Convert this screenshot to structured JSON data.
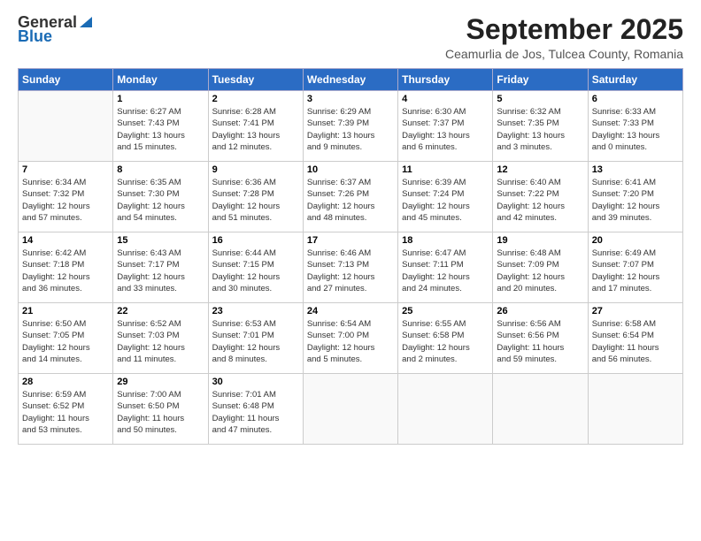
{
  "header": {
    "logo_general": "General",
    "logo_blue": "Blue",
    "month_title": "September 2025",
    "subtitle": "Ceamurlia de Jos, Tulcea County, Romania"
  },
  "weekdays": [
    "Sunday",
    "Monday",
    "Tuesday",
    "Wednesday",
    "Thursday",
    "Friday",
    "Saturday"
  ],
  "weeks": [
    [
      {
        "day": "",
        "info": ""
      },
      {
        "day": "1",
        "info": "Sunrise: 6:27 AM\nSunset: 7:43 PM\nDaylight: 13 hours\nand 15 minutes."
      },
      {
        "day": "2",
        "info": "Sunrise: 6:28 AM\nSunset: 7:41 PM\nDaylight: 13 hours\nand 12 minutes."
      },
      {
        "day": "3",
        "info": "Sunrise: 6:29 AM\nSunset: 7:39 PM\nDaylight: 13 hours\nand 9 minutes."
      },
      {
        "day": "4",
        "info": "Sunrise: 6:30 AM\nSunset: 7:37 PM\nDaylight: 13 hours\nand 6 minutes."
      },
      {
        "day": "5",
        "info": "Sunrise: 6:32 AM\nSunset: 7:35 PM\nDaylight: 13 hours\nand 3 minutes."
      },
      {
        "day": "6",
        "info": "Sunrise: 6:33 AM\nSunset: 7:33 PM\nDaylight: 13 hours\nand 0 minutes."
      }
    ],
    [
      {
        "day": "7",
        "info": "Sunrise: 6:34 AM\nSunset: 7:32 PM\nDaylight: 12 hours\nand 57 minutes."
      },
      {
        "day": "8",
        "info": "Sunrise: 6:35 AM\nSunset: 7:30 PM\nDaylight: 12 hours\nand 54 minutes."
      },
      {
        "day": "9",
        "info": "Sunrise: 6:36 AM\nSunset: 7:28 PM\nDaylight: 12 hours\nand 51 minutes."
      },
      {
        "day": "10",
        "info": "Sunrise: 6:37 AM\nSunset: 7:26 PM\nDaylight: 12 hours\nand 48 minutes."
      },
      {
        "day": "11",
        "info": "Sunrise: 6:39 AM\nSunset: 7:24 PM\nDaylight: 12 hours\nand 45 minutes."
      },
      {
        "day": "12",
        "info": "Sunrise: 6:40 AM\nSunset: 7:22 PM\nDaylight: 12 hours\nand 42 minutes."
      },
      {
        "day": "13",
        "info": "Sunrise: 6:41 AM\nSunset: 7:20 PM\nDaylight: 12 hours\nand 39 minutes."
      }
    ],
    [
      {
        "day": "14",
        "info": "Sunrise: 6:42 AM\nSunset: 7:18 PM\nDaylight: 12 hours\nand 36 minutes."
      },
      {
        "day": "15",
        "info": "Sunrise: 6:43 AM\nSunset: 7:17 PM\nDaylight: 12 hours\nand 33 minutes."
      },
      {
        "day": "16",
        "info": "Sunrise: 6:44 AM\nSunset: 7:15 PM\nDaylight: 12 hours\nand 30 minutes."
      },
      {
        "day": "17",
        "info": "Sunrise: 6:46 AM\nSunset: 7:13 PM\nDaylight: 12 hours\nand 27 minutes."
      },
      {
        "day": "18",
        "info": "Sunrise: 6:47 AM\nSunset: 7:11 PM\nDaylight: 12 hours\nand 24 minutes."
      },
      {
        "day": "19",
        "info": "Sunrise: 6:48 AM\nSunset: 7:09 PM\nDaylight: 12 hours\nand 20 minutes."
      },
      {
        "day": "20",
        "info": "Sunrise: 6:49 AM\nSunset: 7:07 PM\nDaylight: 12 hours\nand 17 minutes."
      }
    ],
    [
      {
        "day": "21",
        "info": "Sunrise: 6:50 AM\nSunset: 7:05 PM\nDaylight: 12 hours\nand 14 minutes."
      },
      {
        "day": "22",
        "info": "Sunrise: 6:52 AM\nSunset: 7:03 PM\nDaylight: 12 hours\nand 11 minutes."
      },
      {
        "day": "23",
        "info": "Sunrise: 6:53 AM\nSunset: 7:01 PM\nDaylight: 12 hours\nand 8 minutes."
      },
      {
        "day": "24",
        "info": "Sunrise: 6:54 AM\nSunset: 7:00 PM\nDaylight: 12 hours\nand 5 minutes."
      },
      {
        "day": "25",
        "info": "Sunrise: 6:55 AM\nSunset: 6:58 PM\nDaylight: 12 hours\nand 2 minutes."
      },
      {
        "day": "26",
        "info": "Sunrise: 6:56 AM\nSunset: 6:56 PM\nDaylight: 11 hours\nand 59 minutes."
      },
      {
        "day": "27",
        "info": "Sunrise: 6:58 AM\nSunset: 6:54 PM\nDaylight: 11 hours\nand 56 minutes."
      }
    ],
    [
      {
        "day": "28",
        "info": "Sunrise: 6:59 AM\nSunset: 6:52 PM\nDaylight: 11 hours\nand 53 minutes."
      },
      {
        "day": "29",
        "info": "Sunrise: 7:00 AM\nSunset: 6:50 PM\nDaylight: 11 hours\nand 50 minutes."
      },
      {
        "day": "30",
        "info": "Sunrise: 7:01 AM\nSunset: 6:48 PM\nDaylight: 11 hours\nand 47 minutes."
      },
      {
        "day": "",
        "info": ""
      },
      {
        "day": "",
        "info": ""
      },
      {
        "day": "",
        "info": ""
      },
      {
        "day": "",
        "info": ""
      }
    ]
  ]
}
